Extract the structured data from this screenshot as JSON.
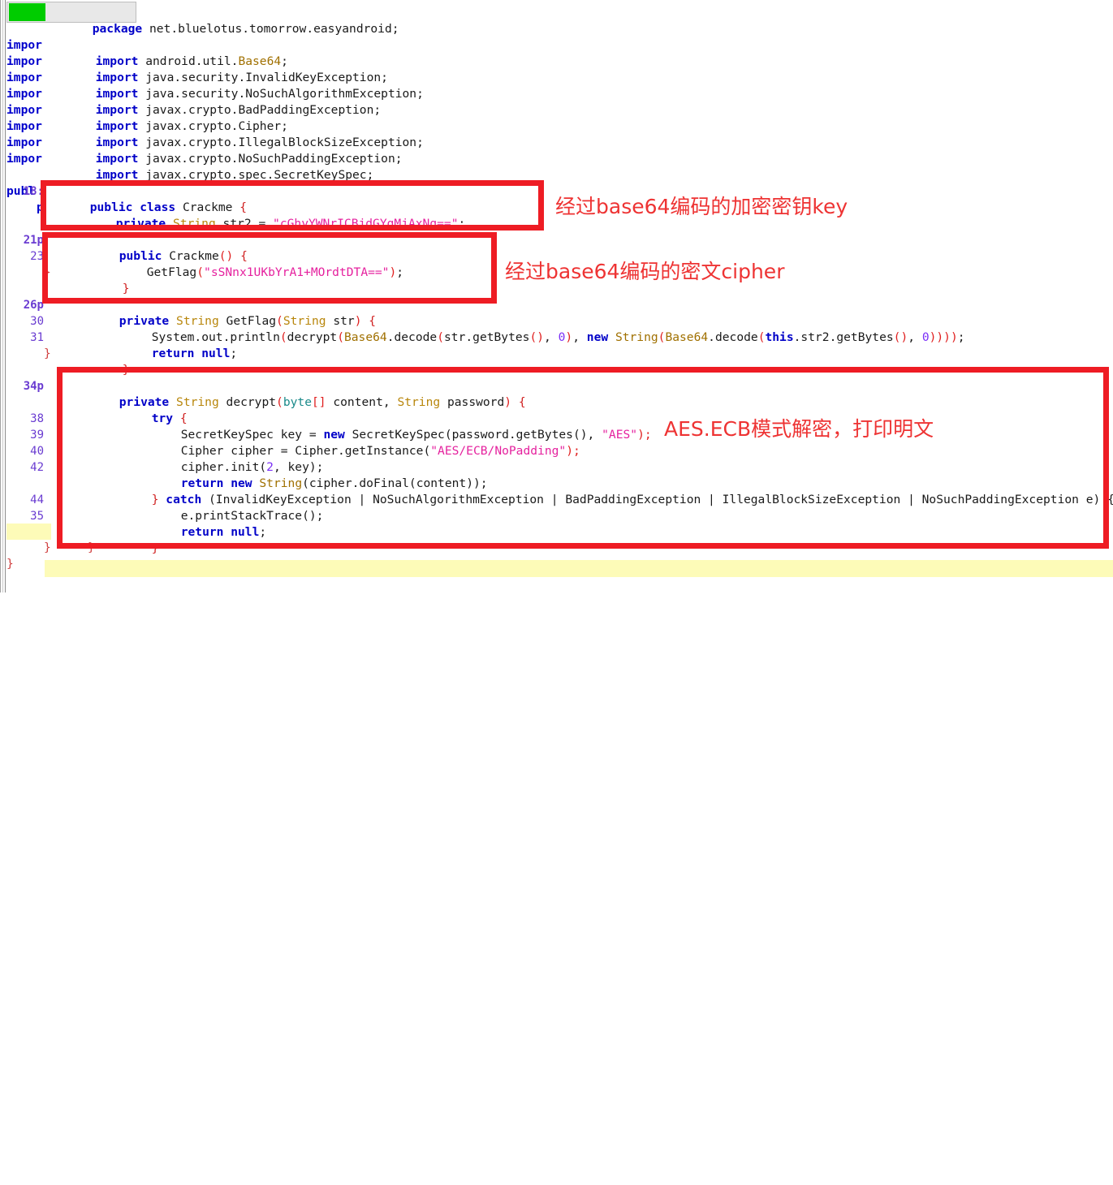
{
  "editor": {
    "marker_color": "#00cc00",
    "annotation_color": "#ee1c24",
    "gutter_color": "#6a3cd1",
    "highlight_color": "#fdfbb8"
  },
  "ghost": {
    "import_label": "impor",
    "public_label": "publ",
    "public_label2": "pub",
    "brace": "}",
    "brace2": "}"
  },
  "gutter": [
    {
      "num": "",
      "bold": false
    },
    {
      "num": "18:",
      "bold": true
    },
    {
      "num": "21p",
      "bold": true
    },
    {
      "num": "23",
      "bold": false
    },
    {
      "num": "26p",
      "bold": true
    },
    {
      "num": "30",
      "bold": false
    },
    {
      "num": "31",
      "bold": false
    },
    {
      "num": "34p",
      "bold": true
    },
    {
      "num": "38",
      "bold": false
    },
    {
      "num": "39",
      "bold": false
    },
    {
      "num": "40",
      "bold": false
    },
    {
      "num": "42",
      "bold": false
    },
    {
      "num": "44",
      "bold": false
    },
    {
      "num": "35",
      "bold": false
    }
  ],
  "code": {
    "package_kw": "package",
    "package_name": " net.bluelotus.tomorrow.easyandroid;",
    "import_kw": "import",
    "imports": [
      {
        "plain": " android.util.",
        "cls": "Base64",
        "tail": ";"
      },
      {
        "plain": " java.security.InvalidKeyException;",
        "cls": "",
        "tail": ""
      },
      {
        "plain": " java.security.NoSuchAlgorithmException;",
        "cls": "",
        "tail": ""
      },
      {
        "plain": " javax.crypto.BadPaddingException;",
        "cls": "",
        "tail": ""
      },
      {
        "plain": " javax.crypto.Cipher;",
        "cls": "",
        "tail": ""
      },
      {
        "plain": " javax.crypto.IllegalBlockSizeException;",
        "cls": "",
        "tail": ""
      },
      {
        "plain": " javax.crypto.NoSuchPaddingException;",
        "cls": "",
        "tail": ""
      },
      {
        "plain": " javax.crypto.spec.SecretKeySpec;",
        "cls": "",
        "tail": ""
      }
    ],
    "class_decl": {
      "kw_public": "public",
      "kw_class": "class",
      "name": "Crackme",
      "brace": "{"
    },
    "field_str2": {
      "kw_private": "private",
      "type": "String",
      "name": " str2 = ",
      "value": "\"cGhyYWNrICBjdGYgMjAxNg==\"",
      "tail": ";"
    },
    "ctor": {
      "kw_public": "public",
      "name": " Crackme",
      "parens": "()",
      "brace": " {"
    },
    "ctor_body": {
      "call": "GetFlag",
      "open": "(",
      "arg": "\"sSNnx1UKbYrA1+MOrdtDTA==\"",
      "close": ")",
      "tail": ";"
    },
    "getflag_sig": {
      "kw_private": "private",
      "type": "String",
      "name": " GetFlag",
      "open": "(",
      "ptype": "String",
      "pname": " str",
      "close": ")",
      "brace": " {"
    },
    "getflag_body": "System.out.println(decrypt(Base64.decode(str.getBytes(), 0), new String(Base64.decode(this.str2.getBytes(), 0))));",
    "return_null": {
      "kw": "return",
      "val": "null",
      "tail": ";"
    },
    "decrypt_sig": {
      "kw_private": "private",
      "type": "String",
      "name": " decrypt",
      "open": "(",
      "p1type": "byte",
      "p1br": "[]",
      "p1name": " content, ",
      "p2type": "String",
      "p2name": " password",
      "close": ")",
      "brace": " {"
    },
    "try_kw": "try",
    "line38": {
      "pre": "SecretKeySpec key = ",
      "kw": "new",
      "mid": " SecretKeySpec(password.getBytes(), ",
      "str": "\"AES\"",
      "tail": ");"
    },
    "line39": {
      "pre": "Cipher cipher = Cipher.getInstance(",
      "str": "\"AES/ECB/NoPadding\"",
      "tail": ");"
    },
    "line40": {
      "pre": "cipher.init(",
      "num": "2",
      "tail": ", key);"
    },
    "line42": {
      "kw_return": "return",
      "kw_new": "new",
      "type": "String",
      "tail": "(cipher.doFinal(content));"
    },
    "catch_line": {
      "brace": "} ",
      "kw": "catch",
      "rest": " (InvalidKeyException | NoSuchAlgorithmException | BadPaddingException | IllegalBlockSizeException | NoSuchPaddingException e) {"
    },
    "print_stack": "e.printStackTrace();",
    "close_brace": "}"
  },
  "annotations": [
    {
      "id": "note-key",
      "text": "经过base64编码的加密密钥key"
    },
    {
      "id": "note-cipher",
      "text": "经过base64编码的密文cipher"
    },
    {
      "id": "note-aes",
      "text": "AES.ECB模式解密，打印明文"
    }
  ]
}
